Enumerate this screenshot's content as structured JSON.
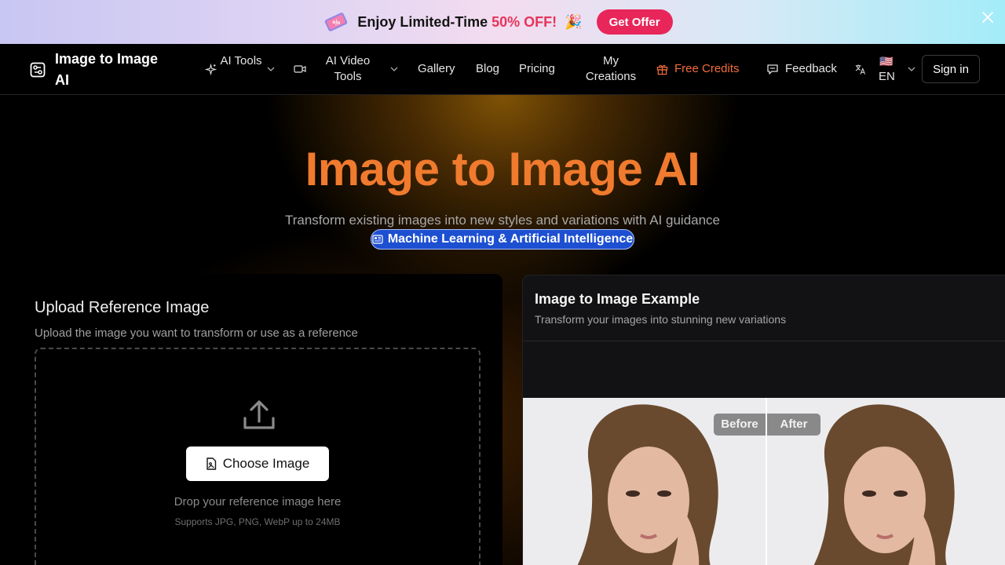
{
  "promo": {
    "text_before": "Enjoy Limited-Time ",
    "percent": "50% OFF!",
    "emoji": "🎉",
    "cta_label": "Get Offer"
  },
  "nav": {
    "brand": "Image to Image AI",
    "ai_tools": "AI Tools",
    "ai_video_tools": "AI Video Tools",
    "gallery": "Gallery",
    "blog": "Blog",
    "pricing": "Pricing",
    "my_creations": "My Creations",
    "free_credits": "Free Credits",
    "feedback": "Feedback",
    "language": "EN",
    "flag": "🇺🇸",
    "sign_in": "Sign in"
  },
  "hero": {
    "title": "Image to Image AI",
    "subtitle": "Transform existing images into new styles and variations with AI guidance",
    "tag": "Machine Learning & Artificial Intelligence"
  },
  "upload": {
    "title": "Upload Reference Image",
    "description": "Upload the image you want to transform or use as a reference",
    "choose_label": "Choose Image",
    "drop_text": "Drop your reference image here",
    "support_text": "Supports JPG, PNG, WebP up to 24MB"
  },
  "example": {
    "title": "Image to Image Example",
    "description": "Transform your images into stunning new variations",
    "before_label": "Before",
    "after_label": "After"
  },
  "colors": {
    "accent_orange": "#f07a2e",
    "promo_pink": "#e8265a",
    "tag_blue": "#1d4fd1"
  }
}
